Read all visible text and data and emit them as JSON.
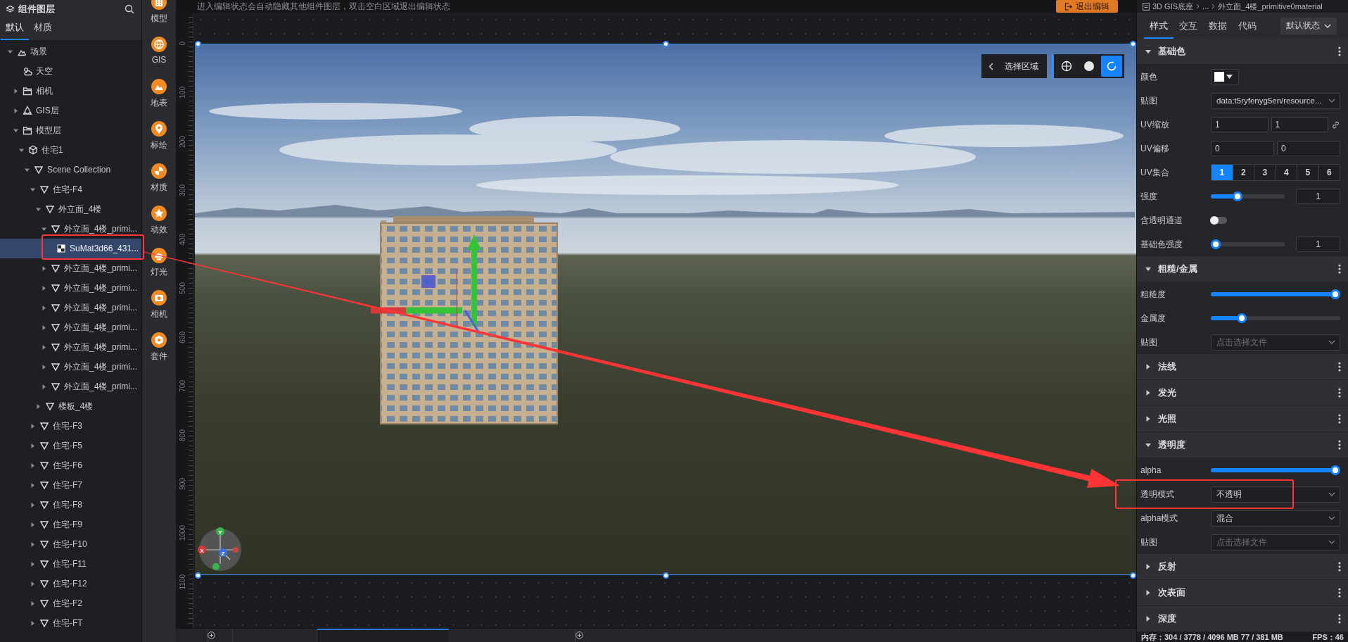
{
  "layer_panel": {
    "title": "组件图层",
    "tabs": [
      {
        "label": "默认",
        "selected": true
      },
      {
        "label": "材质",
        "selected": false
      }
    ],
    "tree": [
      {
        "label": "场景",
        "kind": "scene",
        "expanded": true,
        "selected": false,
        "children": [
          {
            "label": "天空",
            "kind": "sky",
            "selected": false
          },
          {
            "label": "相机",
            "kind": "folder",
            "expanded": false,
            "selected": false
          },
          {
            "label": "GIS层",
            "kind": "gis",
            "expanded": false,
            "selected": false
          },
          {
            "label": "模型层",
            "kind": "folder",
            "expanded": true,
            "selected": false,
            "children": [
              {
                "label": "住宅1",
                "kind": "model",
                "expanded": true,
                "selected": false,
                "children": [
                  {
                    "label": "Scene Collection",
                    "kind": "mesh",
                    "expanded": true,
                    "selected": false,
                    "children": [
                      {
                        "label": "住宅-F4",
                        "kind": "mesh",
                        "expanded": true,
                        "selected": false,
                        "children": [
                          {
                            "label": "外立面_4楼",
                            "kind": "mesh",
                            "expanded": true,
                            "selected": false,
                            "children": [
                              {
                                "label": "外立面_4楼_primi...",
                                "kind": "mesh",
                                "expanded": true,
                                "selected": false,
                                "children": [
                                  {
                                    "label": "SuMat3d66_431...",
                                    "kind": "material",
                                    "selected": true
                                  }
                                ]
                              },
                              {
                                "label": "外立面_4楼_primi...",
                                "kind": "mesh",
                                "expanded": false,
                                "selected": false
                              },
                              {
                                "label": "外立面_4楼_primi...",
                                "kind": "mesh",
                                "expanded": false,
                                "selected": false
                              },
                              {
                                "label": "外立面_4楼_primi...",
                                "kind": "mesh",
                                "expanded": false,
                                "selected": false
                              },
                              {
                                "label": "外立面_4楼_primi...",
                                "kind": "mesh",
                                "expanded": false,
                                "selected": false
                              },
                              {
                                "label": "外立面_4楼_primi...",
                                "kind": "mesh",
                                "expanded": false,
                                "selected": false
                              },
                              {
                                "label": "外立面_4楼_primi...",
                                "kind": "mesh",
                                "expanded": false,
                                "selected": false
                              },
                              {
                                "label": "外立面_4楼_primi...",
                                "kind": "mesh",
                                "expanded": false,
                                "selected": false
                              }
                            ]
                          },
                          {
                            "label": "楼板_4楼",
                            "kind": "mesh",
                            "expanded": false,
                            "selected": false
                          }
                        ]
                      },
                      {
                        "label": "住宅-F3",
                        "kind": "mesh",
                        "expanded": false,
                        "selected": false
                      },
                      {
                        "label": "住宅-F5",
                        "kind": "mesh",
                        "expanded": false,
                        "selected": false
                      },
                      {
                        "label": "住宅-F6",
                        "kind": "mesh",
                        "expanded": false,
                        "selected": false
                      },
                      {
                        "label": "住宅-F7",
                        "kind": "mesh",
                        "expanded": false,
                        "selected": false
                      },
                      {
                        "label": "住宅-F8",
                        "kind": "mesh",
                        "expanded": false,
                        "selected": false
                      },
                      {
                        "label": "住宅-F9",
                        "kind": "mesh",
                        "expanded": false,
                        "selected": false
                      },
                      {
                        "label": "住宅-F10",
                        "kind": "mesh",
                        "expanded": false,
                        "selected": false
                      },
                      {
                        "label": "住宅-F11",
                        "kind": "mesh",
                        "expanded": false,
                        "selected": false
                      },
                      {
                        "label": "住宅-F12",
                        "kind": "mesh",
                        "expanded": false,
                        "selected": false
                      },
                      {
                        "label": "住宅-F2",
                        "kind": "mesh",
                        "expanded": false,
                        "selected": false
                      },
                      {
                        "label": "住宅-FT",
                        "kind": "mesh",
                        "expanded": false,
                        "selected": false
                      }
                    ]
                  }
                ]
              }
            ]
          }
        ]
      }
    ]
  },
  "toolbox": [
    {
      "label": "模型",
      "kind": "model"
    },
    {
      "label": "GIS",
      "kind": "gis"
    },
    {
      "label": "地表",
      "kind": "terrain"
    },
    {
      "label": "标绘",
      "kind": "pin"
    },
    {
      "label": "材质",
      "kind": "material"
    },
    {
      "label": "动效",
      "kind": "effect"
    },
    {
      "label": "灯光",
      "kind": "light"
    },
    {
      "label": "相机",
      "kind": "camera"
    },
    {
      "label": "套件",
      "kind": "kit"
    }
  ],
  "editor": {
    "notice": "进入编辑状态会自动隐藏其他组件图层，双击空白区域退出编辑状态",
    "exit_button": "退出编辑",
    "ruler_labels": [
      "0",
      "100",
      "200",
      "300",
      "400",
      "500",
      "600",
      "700",
      "800",
      "900",
      "1000",
      "1100"
    ],
    "viewport": {
      "area_label": "选择区域",
      "view_modes": [
        {
          "kind": "globe",
          "selected": false
        },
        {
          "kind": "sphere",
          "selected": false
        },
        {
          "kind": "rotate",
          "selected": true
        }
      ],
      "gizmo_labels": [
        "Y",
        "X",
        "Z"
      ]
    }
  },
  "inspector": {
    "breadcrumb": [
      "3D GIS底座",
      "...",
      "外立面_4楼_primitive0material"
    ],
    "tabs": [
      {
        "label": "样式",
        "selected": true
      },
      {
        "label": "交互",
        "selected": false
      },
      {
        "label": "数据",
        "selected": false
      },
      {
        "label": "代码",
        "selected": false
      }
    ],
    "state_select": "默认状态",
    "sections": [
      {
        "title": "基础色",
        "expanded": true,
        "rows": [
          {
            "kind": "color",
            "label": "颜色",
            "color": "#ffffff"
          },
          {
            "kind": "select",
            "label": "贴图",
            "value": "data:t5ryfenyg5en/resource..."
          },
          {
            "kind": "pair",
            "label": "UV缩放",
            "values": [
              "1",
              "1"
            ],
            "linked": true
          },
          {
            "kind": "pair",
            "label": "UV偏移",
            "values": [
              "0",
              "0"
            ],
            "linked": false
          },
          {
            "kind": "segmented",
            "label": "UV集合",
            "options": [
              {
                "label": "1",
                "selected": true
              },
              {
                "label": "2",
                "selected": false
              },
              {
                "label": "3",
                "selected": false
              },
              {
                "label": "4",
                "selected": false
              },
              {
                "label": "5",
                "selected": false
              },
              {
                "label": "6",
                "selected": false
              }
            ]
          },
          {
            "kind": "slider_input",
            "label": "强度",
            "level": 0.34,
            "value": "1"
          },
          {
            "kind": "toggle",
            "label": "含透明通道",
            "on": false
          },
          {
            "kind": "slider_input",
            "label": "基础色强度",
            "level": 0,
            "value": "1"
          }
        ]
      },
      {
        "title": "粗糙/金属",
        "expanded": true,
        "rows": [
          {
            "kind": "slider",
            "label": "粗糙度",
            "level": 1
          },
          {
            "kind": "slider",
            "label": "金属度",
            "level": 0.22
          },
          {
            "kind": "select",
            "label": "贴图",
            "placeholder": "点击选择文件"
          }
        ]
      },
      {
        "title": "法线",
        "expanded": false
      },
      {
        "title": "发光",
        "expanded": false
      },
      {
        "title": "光照",
        "expanded": false
      },
      {
        "title": "透明度",
        "expanded": true,
        "rows": [
          {
            "kind": "slider",
            "label": "alpha",
            "level": 1
          },
          {
            "kind": "select",
            "label": "透明模式",
            "value": "不透明"
          },
          {
            "kind": "select",
            "label": "alpha模式",
            "value": "混合"
          },
          {
            "kind": "select",
            "label": "贴图",
            "placeholder": "点击选择文件"
          }
        ]
      },
      {
        "title": "反射",
        "expanded": false
      },
      {
        "title": "次表面",
        "expanded": false
      },
      {
        "title": "深度",
        "expanded": false
      }
    ],
    "status": {
      "memory": "内存：304 / 3778 / 4096 MB  77 / 381 MB",
      "fps": "FPS：46"
    }
  }
}
